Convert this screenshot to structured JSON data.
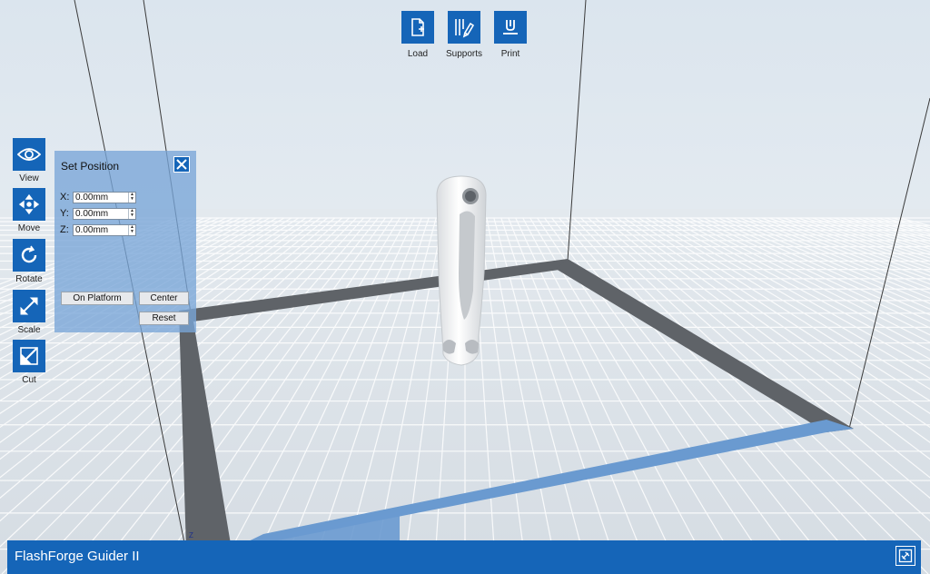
{
  "app": {
    "title": "FlashForge Guider II"
  },
  "top_toolbar": [
    {
      "label": "Load",
      "icon": "load-file-icon"
    },
    {
      "label": "Supports",
      "icon": "supports-icon"
    },
    {
      "label": "Print",
      "icon": "print-icon"
    }
  ],
  "left_toolbar": [
    {
      "label": "View",
      "icon": "eye-icon"
    },
    {
      "label": "Move",
      "icon": "move-arrows-icon"
    },
    {
      "label": "Rotate",
      "icon": "rotate-icon"
    },
    {
      "label": "Scale",
      "icon": "scale-icon"
    },
    {
      "label": "Cut",
      "icon": "cut-icon"
    }
  ],
  "panel": {
    "title": "Set Position",
    "fields": [
      {
        "label": "X:",
        "value": "0.00mm"
      },
      {
        "label": "Y:",
        "value": "0.00mm"
      },
      {
        "label": "Z:",
        "value": "0.00mm"
      }
    ],
    "buttons": {
      "on_platform": "On Platform",
      "center": "Center",
      "reset": "Reset"
    }
  },
  "viewport": {
    "axis_label": "Z"
  },
  "colors": {
    "accent": "#1565b8",
    "panel": "#78a5d7",
    "platform_border": "#5f6368",
    "platform_front_border": "#6a9ad0"
  }
}
